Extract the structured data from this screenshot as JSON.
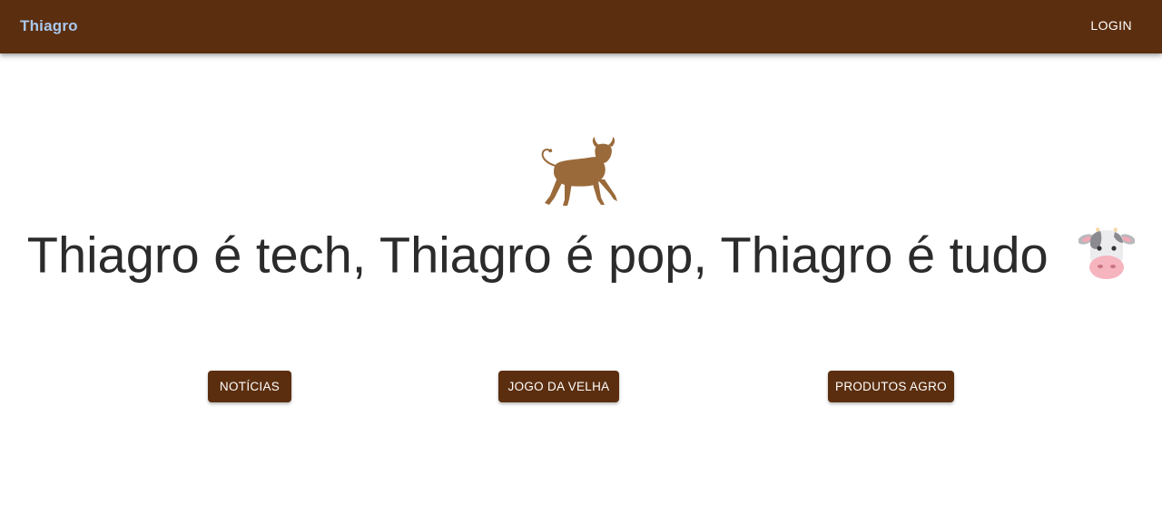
{
  "appbar": {
    "brand": "Thiagro",
    "login_label": "LOGIN",
    "background": "#5b2e0f",
    "brand_color": "#a9c7ee"
  },
  "hero": {
    "icon": "bull-icon",
    "headline": "Thiagro é tech, Thiagro é pop, Thiagro é tudo",
    "headline_emoji": "cow-face-icon"
  },
  "nav_buttons": [
    {
      "label": "NOTÍCIAS"
    },
    {
      "label": "JOGO DA VELHA"
    },
    {
      "label": "PRODUTOS AGRO"
    }
  ],
  "colors": {
    "accent": "#5b2e0f",
    "bull": "#9a6a3a",
    "text": "#2b2b2b"
  }
}
